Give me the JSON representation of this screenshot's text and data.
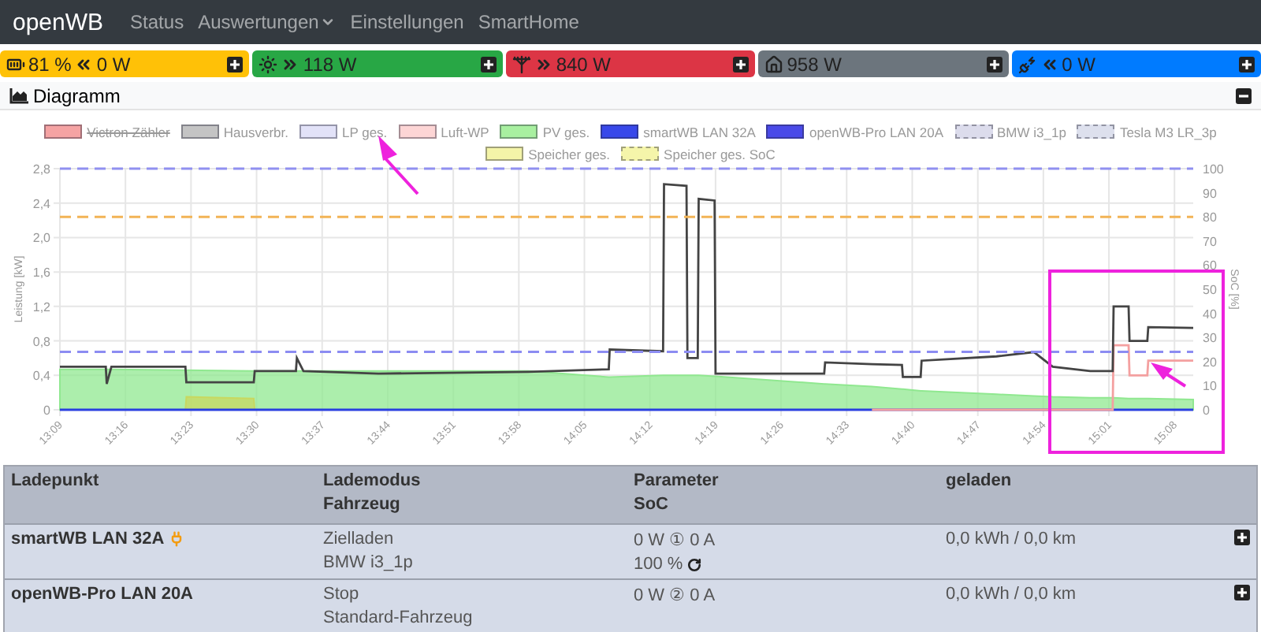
{
  "navbar": {
    "brand": "openWB",
    "items": [
      {
        "label": "Status",
        "dropdown": false
      },
      {
        "label": "Auswertungen",
        "dropdown": true
      },
      {
        "label": "Einstellungen",
        "dropdown": false
      },
      {
        "label": "SmartHome",
        "dropdown": false
      }
    ]
  },
  "status_tiles": [
    {
      "kind": "battery",
      "percent": "81 %",
      "incoming": true,
      "power": "0 W",
      "color": "#ffc107"
    },
    {
      "kind": "pv",
      "incoming": false,
      "power": "118 W",
      "color": "#28a745"
    },
    {
      "kind": "grid",
      "incoming": false,
      "power": "840 W",
      "color": "#dc3545"
    },
    {
      "kind": "house",
      "power": "958 W",
      "color": "#6c757d"
    },
    {
      "kind": "charger",
      "incoming": true,
      "power": "0 W",
      "color": "#007bff"
    }
  ],
  "diagram": {
    "title": "Diagramm",
    "expanded": true,
    "legend": [
      {
        "label": "Victron Zähler",
        "color": "#f5a3a3",
        "dashed": false,
        "hidden": true
      },
      {
        "kind": "series",
        "color": "#c4c4c4",
        "dashed": false,
        "hidden": false
      },
      {
        "label": "LP ges.",
        "color": "#e2e2f8",
        "dashed": false,
        "hidden": false
      },
      {
        "kind": "series",
        "color": "#fdd5d5",
        "dashed": false,
        "hidden": false
      },
      {
        "kind": "series",
        "color": "#a8f0a0",
        "dashed": false,
        "hidden": false
      },
      {
        "kind": "series",
        "color": "#3848ea",
        "dashed": false,
        "hidden": false
      },
      {
        "label": "openWB-Pro LAN 20A",
        "color": "#4a4ae8",
        "dashed": false,
        "hidden": false
      },
      {
        "kind": "series",
        "color": "#dcdcec",
        "dashed": true,
        "hidden": false
      },
      {
        "kind": "series",
        "color": "#dde0ed",
        "dashed": true,
        "hidden": false
      },
      {
        "kind": "series",
        "color": "#f4f4a8",
        "dashed": false,
        "hidden": false
      },
      {
        "kind": "series",
        "color": "#f5f5aa",
        "dashed": true,
        "hidden": false
      }
    ],
    "chart_data": {
      "type": "line",
      "grid": true,
      "ylabel": "Leistung [kW]",
      "y2label": "SoC [%]",
      "xlim": [
        789,
        910
      ],
      "ylim": [
        0,
        2.8
      ],
      "y2lim": [
        0,
        100
      ],
      "xticks": [
        {
          "value": 789,
          "label": "13:09"
        },
        {
          "value": 796,
          "label": "13:16"
        },
        {
          "value": 803,
          "label": "13:23"
        },
        {
          "value": 810,
          "label": "13:30"
        },
        {
          "value": 817,
          "label": "13:37"
        },
        {
          "value": 824,
          "label": "13:44"
        },
        {
          "value": 831,
          "label": "13:51"
        },
        {
          "value": 838,
          "label": "13:58"
        },
        {
          "value": 845,
          "label": "14:05"
        },
        {
          "value": 852,
          "label": "14:12"
        },
        {
          "value": 859,
          "label": "14:19"
        },
        {
          "value": 866,
          "label": "14:26"
        },
        {
          "value": 873,
          "label": "14:33"
        },
        {
          "value": 880,
          "label": "14:40"
        },
        {
          "value": 887,
          "label": "14:47"
        },
        {
          "value": 894,
          "label": "14:54"
        },
        {
          "value": 901,
          "label": "15:01"
        },
        {
          "value": 908,
          "label": "15:08"
        }
      ],
      "yticks": [
        {
          "value": 0,
          "label": "0"
        },
        {
          "value": 0.4,
          "label": "0,4"
        },
        {
          "value": 0.8,
          "label": "0,8"
        },
        {
          "value": 1.2,
          "label": "1,2"
        },
        {
          "value": 1.6,
          "label": "1,6"
        },
        {
          "value": 2.0,
          "label": "2,0"
        },
        {
          "value": 2.4,
          "label": "2,4"
        },
        {
          "value": 2.8,
          "label": "2,8"
        }
      ],
      "y2ticks": [
        0,
        10,
        20,
        30,
        40,
        50,
        60,
        70,
        80,
        90,
        100
      ],
      "x": [
        789,
        793.9,
        794,
        794.5,
        802.4,
        802.5,
        809.7,
        809.8,
        814.2,
        814.3,
        815,
        823,
        839,
        847.6,
        847.7,
        853.4,
        853.5,
        855.9,
        856,
        857.1,
        857.2,
        858.9,
        859,
        870.6,
        870.7,
        875.7,
        878.9,
        879,
        880.9,
        881,
        889,
        893,
        895,
        899,
        901.4,
        901.5,
        903.1,
        903.2,
        905.1,
        905.2,
        910
      ],
      "series": [
        {
          "name": "Hausverbr.",
          "color": "#444444",
          "values": [
            0.5,
            0.5,
            0.3,
            0.5,
            0.5,
            0.32,
            0.32,
            0.45,
            0.45,
            0.6,
            0.45,
            0.42,
            0.44,
            0.47,
            0.7,
            0.68,
            2.62,
            2.6,
            0.6,
            0.6,
            2.45,
            2.43,
            0.42,
            0.42,
            0.55,
            0.53,
            0.52,
            0.38,
            0.38,
            0.57,
            0.62,
            0.67,
            0.5,
            0.45,
            0.45,
            1.2,
            1.2,
            0.8,
            0.8,
            0.96,
            0.95
          ]
        },
        {
          "name": "Luft-WP",
          "color": "#f4a0a0",
          "values": [
            null,
            null,
            null,
            null,
            null,
            null,
            null,
            null,
            null,
            null,
            null,
            null,
            null,
            null,
            null,
            null,
            null,
            null,
            null,
            null,
            null,
            null,
            null,
            null,
            null,
            0,
            0,
            0,
            0,
            0,
            0,
            0,
            0,
            0,
            0,
            0.75,
            0.75,
            0.4,
            0.4,
            0.57,
            0.57
          ]
        },
        {
          "name": "PV ges.",
          "type": "area",
          "color": "#90e890",
          "values": [
            0.47,
            0.47,
            0.47,
            0.47,
            0.46,
            0.46,
            0.45,
            0.45,
            0.45,
            0.45,
            0.45,
            0.45,
            0.45,
            0.38,
            0.38,
            0.4,
            0.4,
            0.4,
            0.4,
            0.4,
            0.4,
            0.39,
            0.39,
            0.3,
            0.3,
            0.27,
            0.24,
            0.24,
            0.22,
            0.22,
            0.18,
            0.16,
            0.15,
            0.14,
            0.14,
            0.14,
            0.13,
            0.13,
            0.13,
            0.13,
            0.12
          ]
        },
        {
          "name": "smartWB LAN 32A",
          "color": "#2a3fe0",
          "values": [
            0,
            0,
            0,
            0,
            0,
            0,
            0,
            0,
            0,
            0,
            0,
            0,
            0,
            0,
            0,
            0,
            0,
            0,
            0,
            0,
            0,
            0,
            0,
            0,
            0,
            0,
            0,
            0,
            0,
            0,
            0,
            0,
            0,
            0,
            0,
            0,
            0,
            0,
            0,
            0,
            0
          ]
        },
        {
          "name": "BMW i3_1p",
          "axis": "y2",
          "line_style": "dashed",
          "color": "#9090f0",
          "values": [
            100,
            100,
            100,
            100,
            100,
            100,
            100,
            100,
            100,
            100,
            100,
            100,
            100,
            100,
            100,
            100,
            100,
            100,
            100,
            100,
            100,
            100,
            100,
            100,
            100,
            100,
            100,
            100,
            100,
            100,
            100,
            100,
            100,
            100,
            100,
            100,
            100,
            100,
            100,
            100,
            100
          ]
        },
        {
          "name": "Tesla M3 LR_3p",
          "axis": "y2",
          "line_style": "dashed",
          "color": "#8c8cf2",
          "values": [
            24,
            24,
            24,
            24,
            24,
            24,
            24,
            24,
            24,
            24,
            24,
            24,
            24,
            24,
            24,
            24,
            24,
            24,
            24,
            24,
            24,
            24,
            24,
            24,
            24,
            24,
            24,
            24,
            24,
            24,
            24,
            24,
            24,
            24,
            24,
            24,
            24,
            24,
            24,
            24,
            24
          ]
        },
        {
          "name": "Speicher ges.",
          "type": "area",
          "color": "#c8d860",
          "values": [
            0,
            0,
            0,
            0,
            0,
            0.15,
            0.13,
            0,
            0,
            0,
            0,
            0,
            0,
            0,
            0,
            0,
            0,
            0,
            0,
            0,
            0,
            0,
            0,
            0,
            0,
            0,
            0,
            0,
            0,
            0,
            0,
            0,
            0,
            0,
            0,
            0,
            0,
            0,
            0,
            0,
            0
          ]
        },
        {
          "name": "Speicher ges. SoC",
          "axis": "y2",
          "line_style": "dashed",
          "color": "#f2b456",
          "values": [
            80,
            80,
            80,
            80,
            80,
            80,
            80,
            80,
            80,
            80,
            80,
            80,
            80,
            80,
            80,
            80,
            80,
            80,
            80,
            80,
            80,
            80,
            80,
            80,
            80,
            80,
            80,
            80,
            80,
            80,
            80,
            80,
            80,
            80,
            80,
            80,
            80,
            80,
            80,
            80,
            80
          ]
        }
      ]
    }
  },
  "table": {
    "columns": [
      {
        "lines": [
          "Ladepunkt"
        ]
      },
      {
        "lines": [
          "Lademodus",
          "Fahrzeug"
        ]
      },
      {
        "lines": [
          "Parameter",
          "SoC"
        ]
      },
      {
        "lines": [
          "geladen"
        ]
      }
    ],
    "rows": [
      {
        "name": "smartWB LAN 32A",
        "plugged": true,
        "mode": "Zielladen",
        "vehicle": "BMW i3_1p",
        "parameter": "0 W ① 0 A",
        "soc": "100 %",
        "soc_refresh": true,
        "charged": "0,0 kWh / 0,0 km",
        "expanded": false
      },
      {
        "name": "openWB-Pro LAN 20A",
        "plugged": false,
        "mode": "Stop",
        "vehicle": "Standard-Fahrzeug",
        "parameter": "0 W ② 0 A",
        "charged": "0,0 kWh / 0,0 km",
        "expanded": false
      }
    ]
  }
}
